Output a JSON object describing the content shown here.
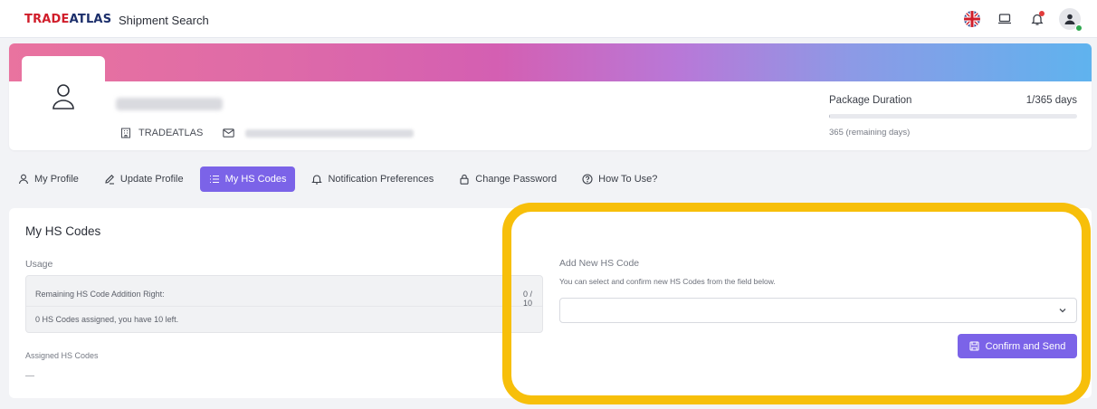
{
  "header": {
    "brand_part1": "TRADE",
    "brand_part2": "ATLAS",
    "app_title": "Shipment Search",
    "icons": [
      "uk-flag-icon",
      "laptop-icon",
      "bell-icon",
      "user-avatar-icon"
    ]
  },
  "profile": {
    "organization": "TRADEATLAS",
    "package_duration_label": "Package Duration",
    "package_duration_value": "1/365 days",
    "package_progress": 0.003,
    "remaining_days": "365 (remaining days)"
  },
  "tabs": [
    {
      "label": "My Profile",
      "icon": "person-icon",
      "active": false
    },
    {
      "label": "Update Profile",
      "icon": "edit-icon",
      "active": false
    },
    {
      "label": "My HS Codes",
      "icon": "list-icon",
      "active": true
    },
    {
      "label": "Notification Preferences",
      "icon": "bell-icon",
      "active": false
    },
    {
      "label": "Change Password",
      "icon": "lock-icon",
      "active": false
    },
    {
      "label": "How To Use?",
      "icon": "help-icon",
      "active": false
    }
  ],
  "hs_codes": {
    "title": "My HS Codes",
    "usage_label": "Usage",
    "remaining_label": "Remaining HS Code Addition Right:",
    "remaining_count": "0 / 10",
    "assigned_summary": "0 HS Codes assigned, you have 10 left.",
    "assigned_label": "Assigned HS Codes",
    "assigned_value": "—",
    "add_label": "Add New HS Code",
    "add_description": "You can select and confirm new HS Codes from the field below.",
    "select_value": "",
    "confirm_button": "Confirm and Send"
  },
  "colors": {
    "accent": "#7b63e8",
    "highlight": "#f7bf0a",
    "brand_red": "#d01d2a",
    "brand_navy": "#1c2f6b"
  }
}
